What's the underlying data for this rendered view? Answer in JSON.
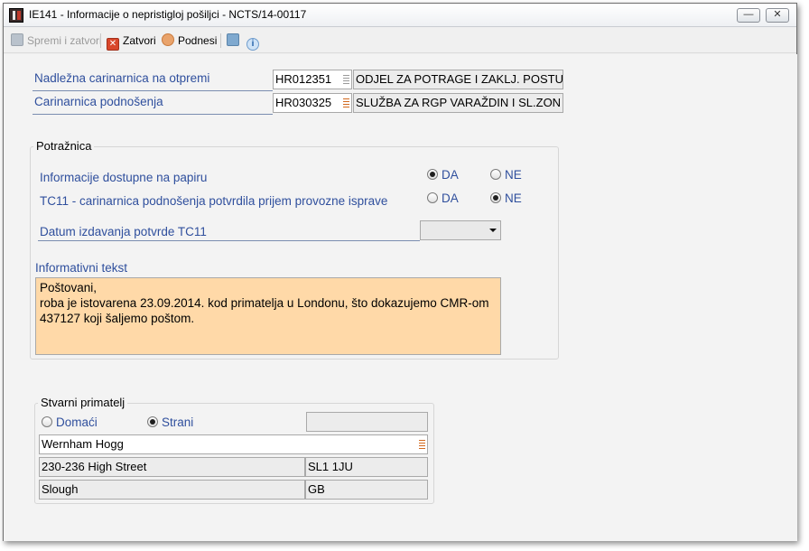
{
  "window": {
    "title": "IE141 - Informacije o nepristigloj pošiljci - NCTS/14-00117",
    "minimize": "—",
    "close": "✕"
  },
  "toolbar": {
    "save_close": "Spremi i zatvori",
    "close": "Zatvori",
    "submit": "Podnesi"
  },
  "customs": {
    "dispatch_label": "Nadležna carinarnica na otpremi",
    "dispatch_code": "HR012351",
    "dispatch_name": "ODJEL ZA POTRAGE I ZAKLJ. POSTU",
    "submission_label": "Carinarnica podnošenja",
    "submission_code": "HR030325",
    "submission_name": "SLUŽBA ZA RGP VARAŽDIN I SL.ZON"
  },
  "claim": {
    "title": "Potražnica",
    "paper_info_label": "Informacije dostupne na papiru",
    "paper_info_yes": "DA",
    "paper_info_no": "NE",
    "paper_info_value": "DA",
    "tc11_label": "TC11 - carinarnica podnošenja potvrdila prijem provozne isprave",
    "tc11_yes": "DA",
    "tc11_no": "NE",
    "tc11_value": "NE",
    "tc11_date_label": "Datum izdavanja potvrde TC11",
    "tc11_date_value": "",
    "info_text_label": "Informativni tekst",
    "info_text": "Poštovani,\nroba je istovarena 23.09.2014. kod primatelja u Londonu, što dokazujemo CMR-om\n437127 koji šaljemo poštom."
  },
  "consignee": {
    "title": "Stvarni primatelj",
    "domestic": "Domaći",
    "foreign": "Strani",
    "type_value": "Strani",
    "id_value": "",
    "name": "Wernham Hogg",
    "street": "230-236 High Street",
    "postcode": "SL1 1JU",
    "city": "Slough",
    "country": "GB"
  },
  "colors": {
    "label_blue": "#2f4f9d",
    "textarea_bg": "#ffd9a8"
  }
}
